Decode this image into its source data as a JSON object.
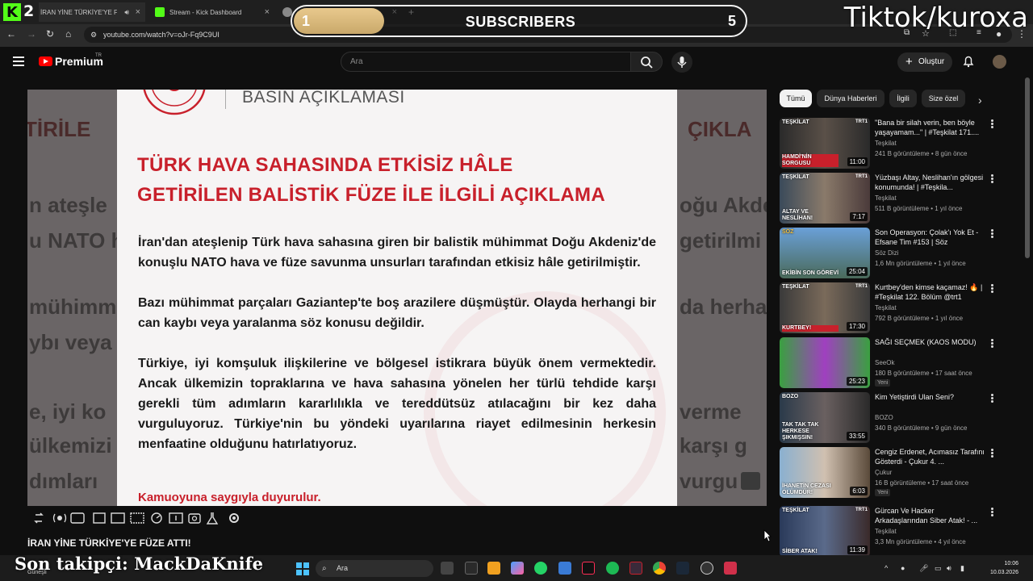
{
  "browser": {
    "kick_count": "2",
    "tabs": [
      {
        "label": "İRAN YİNE TÜRKİYE'YE FÜZE",
        "active": true
      },
      {
        "label": "Stream - Kick Dashboard",
        "active": false
      },
      {
        "label": "",
        "active": false
      }
    ],
    "new_tab": "+",
    "url": "youtube.com/watch?v=oJr-Fq9C9UI"
  },
  "overlay": {
    "progress_current": "1",
    "label": "SUBSCRIBERS",
    "goal": "5",
    "progress_fraction": 0.2,
    "watermark": "Tiktok/kuroxa"
  },
  "youtube": {
    "brand": "Premium",
    "region": "TR",
    "search_placeholder": "Ara",
    "create_label": "Oluştur"
  },
  "video": {
    "title": "İRAN YİNE TÜRKİYE'YE FÜZE ATTI!",
    "doc_header": "BASIN AÇIKLAMASI",
    "doc_title_line1": "TÜRK HAVA SAHASINDA ETKİSİZ HÂLE",
    "doc_title_line2": "GETİRİLEN BALİSTİK FÜZE İLE İLGİLİ AÇIKLAMA",
    "paragraph1": "İran'dan ateşlenip Türk hava sahasına giren bir balistik mühimmat Doğu Akdeniz'de konuşlu NATO hava ve füze savunma unsurları tarafından etkisiz hâle getirilmiştir.",
    "paragraph2": "Bazı mühimmat parçaları Gaziantep'te boş arazilere düşmüştür. Olayda herhangi bir can kaybı veya yaralanma söz konusu değildir.",
    "paragraph3": "Türkiye, iyi komşuluk ilişkilerine ve bölgesel istikrara büyük önem vermektedir. Ancak ülkemizin topraklarına ve hava sahasına yönelen her türlü tehdide karşı gerekli tüm adımların kararlılıkla ve tereddütsüz atılacağını bir kez daha vurguluyoruz. Türkiye'nin bu yöndeki uyarılarına riayet edilmesinin herkesin menfaatine olduğunu hatırlatıyoruz.",
    "signature": "Kamuoyuna saygıyla duyurulur.",
    "bg_fragments": [
      "TİRİLE",
      "ÇIKLA",
      "n ateşle",
      "oğu Akde",
      "u NATO h",
      "getirilmi",
      "mühimma",
      "da herha",
      "ybı veya",
      "e, iyi ko",
      "verme",
      "ülkemizi",
      "karşı g",
      "dımları",
      "vurgu"
    ]
  },
  "sidebar": {
    "chips": [
      "Tümü",
      "Dünya Haberleri",
      "İlgili",
      "Size özel"
    ],
    "videos": [
      {
        "title": "\"Bana bir silah verin, ben böyle yaşayamam...\" | #Teşkilat 171....",
        "channel": "Teşkilat",
        "meta": "241 B görüntüleme • 8 gün önce",
        "duration": "11:00",
        "thumb_tag": "TEŞKİLAT",
        "thumb_caption": "HAMDİ'NİN SORGUSU",
        "new": ""
      },
      {
        "title": "Yüzbaşı Altay, Neslihan'ın gölgesi konumunda! | #Teşkila...",
        "channel": "Teşkilat",
        "meta": "511 B görüntüleme • 1 yıl önce",
        "duration": "7:17",
        "thumb_tag": "TEŞKİLAT",
        "thumb_caption": "ALTAY VE NESLİHAN!",
        "new": ""
      },
      {
        "title": "Son Operasyon: Çolak'ı Yok Et - Efsane Tim #153 | Söz",
        "channel": "Söz Dizi",
        "meta": "1,6 Mn görüntüleme • 1 yıl önce",
        "duration": "25:04",
        "thumb_tag": "SÖZ",
        "thumb_caption": "EKİBİN SON GÖREVİ",
        "new": ""
      },
      {
        "title": "Kurtbey'den kimse kaçamaz! 🔥 | #Teşkilat 122. Bölüm @trt1",
        "channel": "Teşkilat",
        "meta": "792 B görüntüleme • 1 yıl önce",
        "duration": "17:30",
        "thumb_tag": "TEŞKİLAT",
        "thumb_caption": "KURTBEY!",
        "new": ""
      },
      {
        "title": "SAĞI SEÇMEK (KAOS MODU)",
        "channel": "SeeOk",
        "meta": "180 B görüntüleme • 17 saat önce",
        "duration": "25:23",
        "thumb_tag": "",
        "thumb_caption": "",
        "new": "Yeni"
      },
      {
        "title": "Kim Yetiştirdi Ulan Seni?",
        "channel": "BOZO",
        "meta": "340 B görüntüleme • 9 gün önce",
        "duration": "33:55",
        "thumb_tag": "BOZO",
        "thumb_caption": "TAK TAK TAK HERKESE ŞIKMIŞSIN!",
        "new": ""
      },
      {
        "title": "Cengiz Erdenet, Acımasız Tarafını Gösterdi - Çukur 4. ...",
        "channel": "Çukur",
        "meta": "16 B görüntüleme • 17 saat önce",
        "duration": "6:03",
        "thumb_tag": "",
        "thumb_caption": "İHANETİN CEZASI ÖLÜMDÜR!",
        "new": "Yeni"
      },
      {
        "title": "Gürcan Ve Hacker Arkadaşlarından Siber Atak! - ...",
        "channel": "Teşkilat",
        "meta": "3,3 Mn görüntüleme • 4 yıl önce",
        "duration": "11:39",
        "thumb_tag": "TEŞKİLAT",
        "thumb_caption": "SİBER ATAK!",
        "new": ""
      }
    ]
  },
  "stream": {
    "last_follower": "Son takipçi: MackDaKnife"
  },
  "taskbar": {
    "weather": "Güneşli",
    "search_placeholder": "Ara",
    "time": "10:06",
    "date": "10.03.2026"
  },
  "colors": {
    "accent_red": "#c8202b",
    "kick_green": "#53fc18",
    "yt_red": "#ff0000"
  }
}
